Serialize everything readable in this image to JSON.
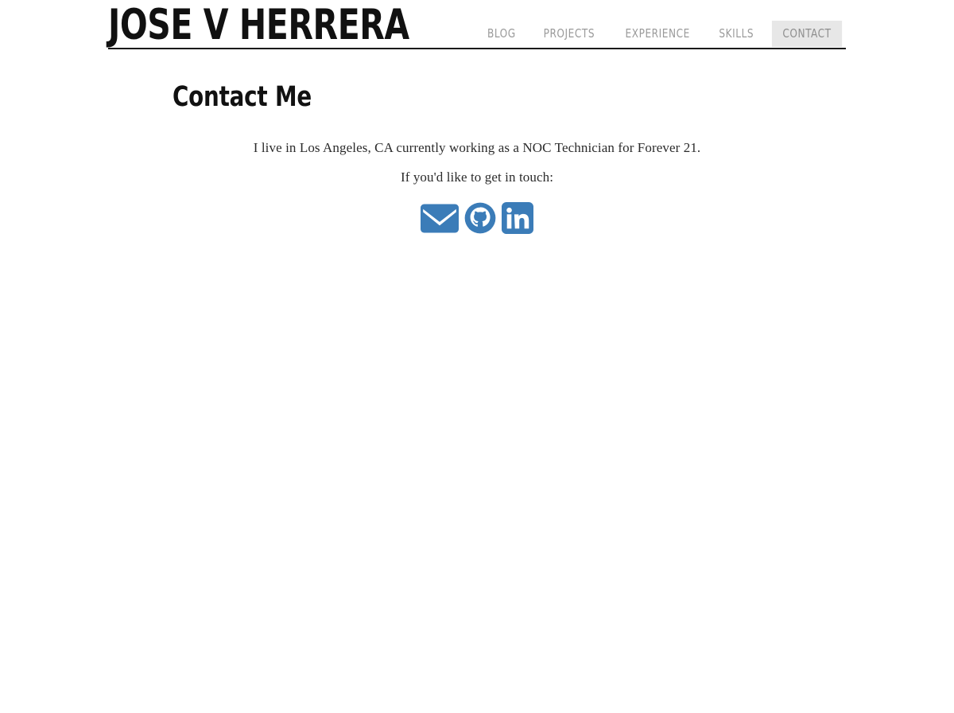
{
  "site": {
    "title": "JOSE V HERRERA",
    "background_color": "#ffffff",
    "accent_color": "#3b7cb8",
    "active_nav_background": "#e7e7e7",
    "nav_text_color": "#9a9a9a",
    "header_rule_color": "#1a1a1a"
  },
  "nav": {
    "items": [
      {
        "label": "BLOG",
        "active": false
      },
      {
        "label": "PROJECTS",
        "active": false
      },
      {
        "label": "EXPERIENCE",
        "active": false
      },
      {
        "label": "SKILLS",
        "active": false
      },
      {
        "label": "CONTACT",
        "active": true
      }
    ]
  },
  "main": {
    "heading": "Contact Me",
    "paragraphs": [
      "I live in Los Angeles, CA currently working as a NOC Technician for Forever 21.",
      "If you'd like to get in touch:"
    ],
    "social_links": [
      {
        "name": "email-icon",
        "label": "Email"
      },
      {
        "name": "github-icon",
        "label": "GitHub"
      },
      {
        "name": "linkedin-icon",
        "label": "LinkedIn"
      }
    ]
  }
}
